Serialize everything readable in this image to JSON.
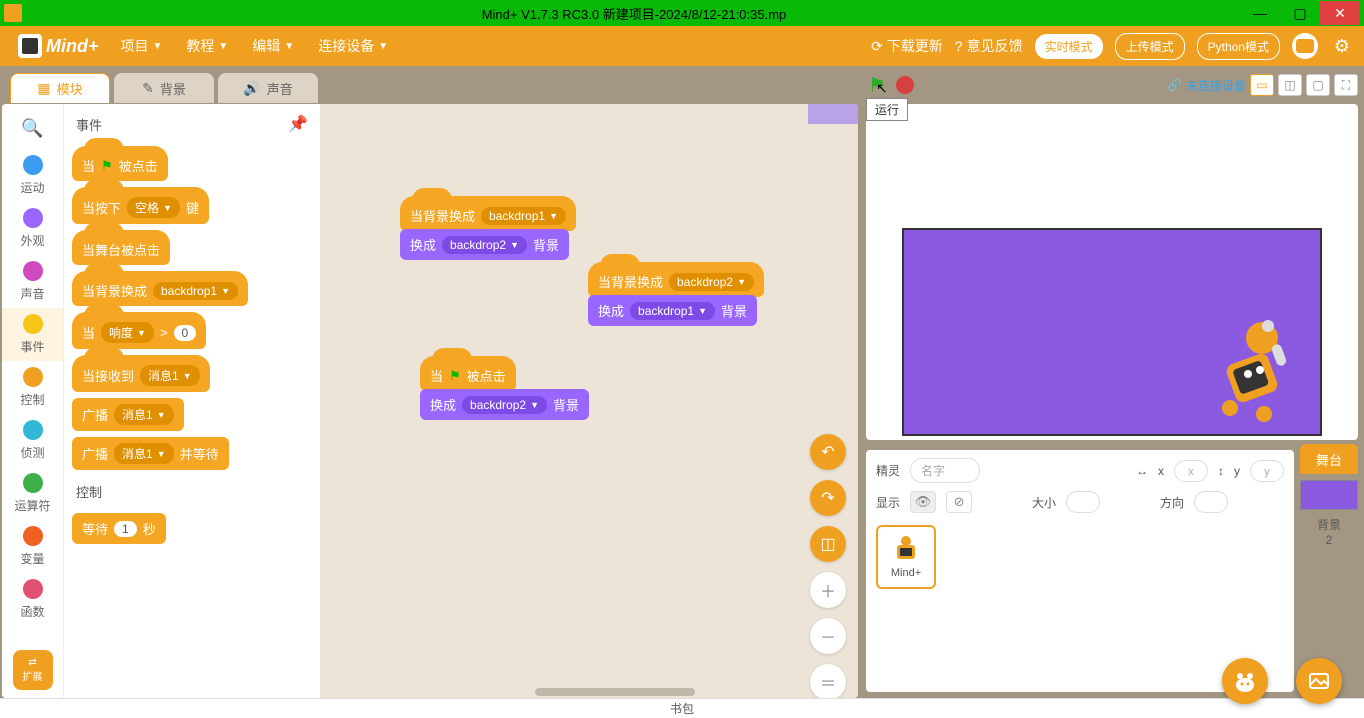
{
  "title": "Mind+ V1.7.3 RC3.0   新建项目-2024/8/12-21:0:35.mp",
  "menu": {
    "project": "项目",
    "tutorial": "教程",
    "edit": "编辑",
    "connect": "连接设备",
    "download": "下载更新",
    "feedback": "意见反馈"
  },
  "modes": {
    "realtime": "实时模式",
    "upload": "上传模式",
    "python": "Python模式"
  },
  "logo": "Mind+",
  "tabs": {
    "blocks": "模块",
    "backdrops": "背景",
    "sounds": "声音"
  },
  "categories": {
    "motion": "运动",
    "looks": "外观",
    "sound": "声音",
    "events": "事件",
    "control": "控制",
    "sensing": "侦测",
    "operators": "运算符",
    "variables": "变量",
    "functions": "函数",
    "extension": "扩展"
  },
  "palette": {
    "header_events": "事件",
    "header_control": "控制",
    "when_flag_clicked_a": "当",
    "when_flag_clicked_b": "被点击",
    "when_key_a": "当按下",
    "when_key_key": "空格",
    "when_key_b": "键",
    "when_stage_clicked": "当舞台被点击",
    "when_backdrop_a": "当背景换成",
    "when_backdrop_dd": "backdrop1",
    "when_gt_a": "当",
    "when_gt_dd": "响度",
    "when_gt_op": ">",
    "when_gt_val": "0",
    "when_receive_a": "当接收到",
    "when_receive_dd": "消息1",
    "broadcast_a": "广播",
    "broadcast_dd": "消息1",
    "broadcast_wait_a": "广播",
    "broadcast_wait_dd": "消息1",
    "broadcast_wait_b": "并等待",
    "wait_a": "等待",
    "wait_val": "1",
    "wait_b": "秒"
  },
  "workspace": {
    "s1_hat_a": "当背景换成",
    "s1_hat_dd": "backdrop1",
    "s1_b_a": "换成",
    "s1_b_dd": "backdrop2",
    "s1_b_b": "背景",
    "s2_hat_a": "当背景换成",
    "s2_hat_dd": "backdrop2",
    "s2_b_a": "换成",
    "s2_b_dd": "backdrop1",
    "s2_b_b": "背景",
    "s3_hat_a": "当",
    "s3_hat_b": "被点击",
    "s3_b_a": "换成",
    "s3_b_dd": "backdrop2",
    "s3_b_b": "背景"
  },
  "stage_header": {
    "run_tooltip": "运行",
    "device_status": "未连接设备"
  },
  "sprite_panel": {
    "sprite_label": "精灵",
    "name_placeholder": "名字",
    "x_label": "x",
    "x_val": "x",
    "y_label": "y",
    "y_val": "y",
    "show_label": "显示",
    "size_label": "大小",
    "direction_label": "方向",
    "sprite_name": "Mind+"
  },
  "stage_side": {
    "stage": "舞台",
    "backdrop": "背景",
    "count": "2"
  },
  "footer": {
    "backpack": "书包"
  }
}
